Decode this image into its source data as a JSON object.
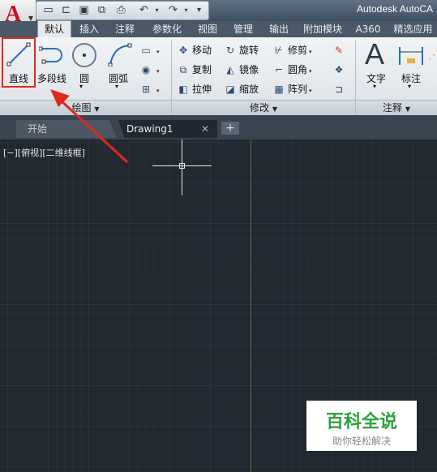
{
  "window": {
    "title": "Autodesk AutoCA"
  },
  "quick_access": {
    "icons": [
      "new-icon",
      "open-icon",
      "save-icon",
      "save-as-icon",
      "print-icon",
      "undo-icon",
      "redo-icon",
      "customize-icon"
    ]
  },
  "ribbon_tabs": [
    "默认",
    "插入",
    "注释",
    "参数化",
    "视图",
    "管理",
    "输出",
    "附加模块",
    "A360",
    "精选应用"
  ],
  "ribbon": {
    "draw": {
      "title": "绘图",
      "big_buttons": [
        "直线",
        "多段线",
        "圆",
        "圆弧"
      ]
    },
    "modify": {
      "title": "修改",
      "small_buttons": [
        "移动",
        "旋转",
        "修剪",
        "复制",
        "镜像",
        "圆角",
        "拉伸",
        "缩放",
        "阵列"
      ]
    },
    "annotation": {
      "title": "注释",
      "big_buttons": [
        "文字",
        "标注"
      ]
    }
  },
  "file_tabs": {
    "start": "开始",
    "drawing": "Drawing1",
    "add": "+"
  },
  "canvas": {
    "viewport_label": "[−][俯视][二维线框]"
  },
  "watermark": {
    "title": "百科全说",
    "subtitle": "助你轻松解决"
  },
  "colors": {
    "highlight": "#e0281f",
    "canvas_bg": "#212830",
    "watermark_green": "#2da33f"
  }
}
